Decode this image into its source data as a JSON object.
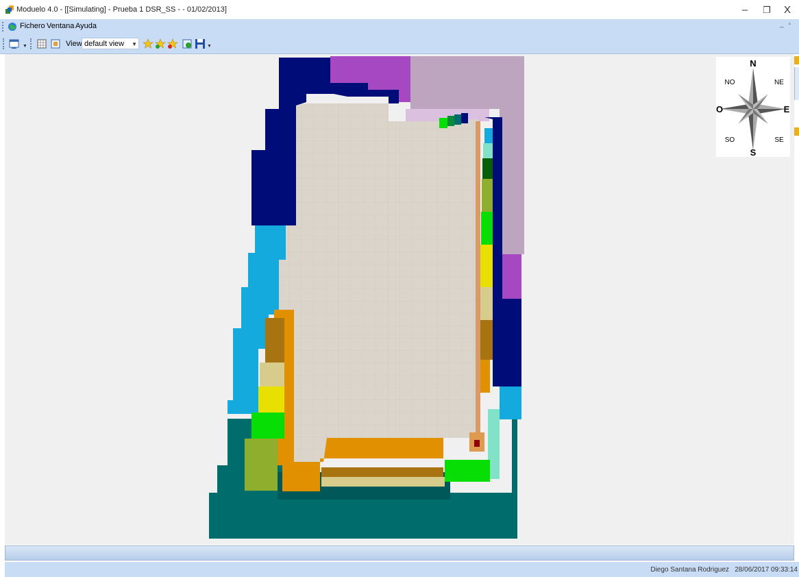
{
  "window": {
    "title": "Moduelo 4.0 - [[Simulating] - Prueba 1 DSR_SS - - 01/02/2013]",
    "minimize": "–",
    "restore": "❐",
    "close": "X"
  },
  "menu": {
    "items": [
      "Fichero",
      "Ventana",
      "Ayuda"
    ],
    "mdi_controls": "_ ▫"
  },
  "toolbar": {
    "view_label": "View:",
    "view_value": "default view"
  },
  "compass": {
    "N": "N",
    "NE": "NE",
    "E": "E",
    "SE": "SE",
    "S": "S",
    "SO": "SO",
    "O": "O",
    "NO": "NO"
  },
  "status": {
    "user": "Diego Santana Rodriguez",
    "datetime": "28/06/2017 09:33:14"
  },
  "colors": {
    "navy": "#000c78",
    "cyan": "#14aade",
    "teal": "#006d6d",
    "beige": "#dad4cb",
    "orange": "#e09000",
    "purple": "#a548c2",
    "mauve": "#bea5bf",
    "green": "#06de06",
    "olive": "#8fae2e",
    "yellow": "#e8e000",
    "khaki": "#d8cc8c",
    "brown": "#a87412",
    "mint": "#82e2c8",
    "darkred": "#8b0000"
  }
}
